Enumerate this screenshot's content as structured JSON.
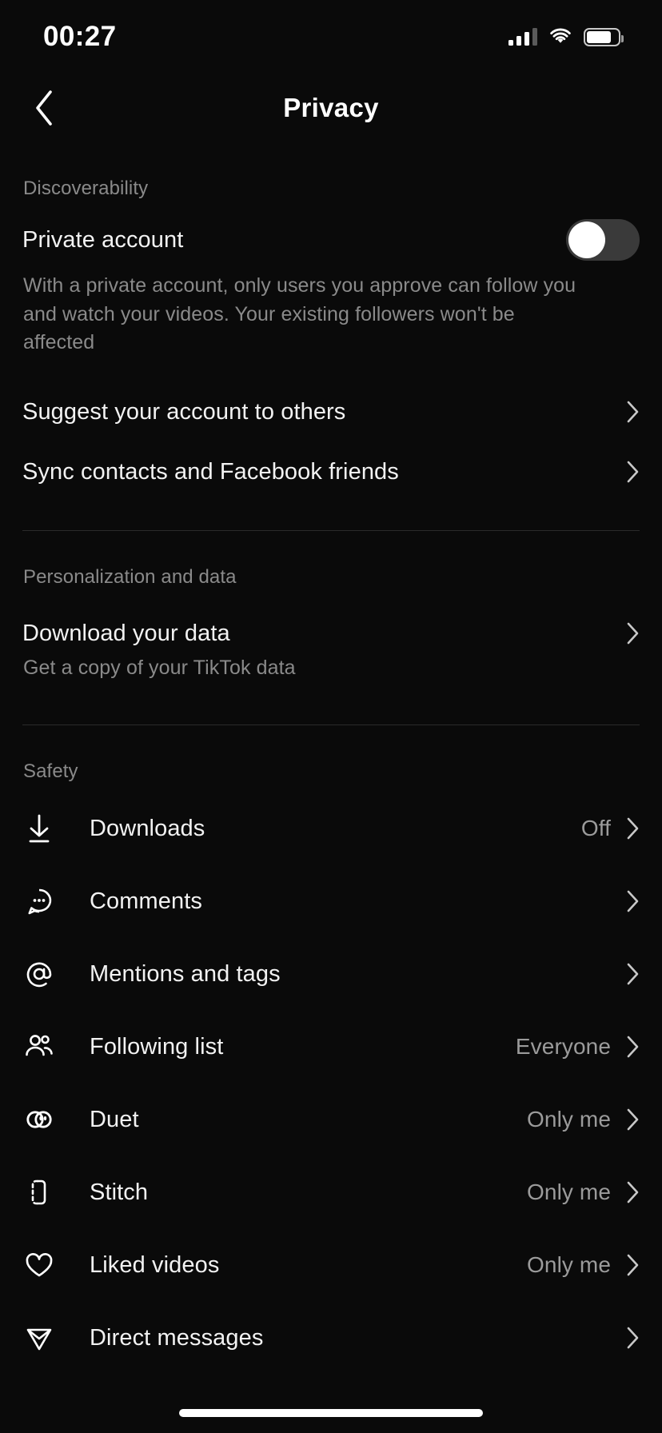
{
  "status_bar": {
    "time": "00:27",
    "signal_icon": "cellular-signal-icon",
    "wifi_icon": "wifi-icon",
    "battery_icon": "battery-icon",
    "battery_level": "80"
  },
  "nav": {
    "back_icon": "chevron-left-icon",
    "title": "Privacy"
  },
  "sections": {
    "discoverability": {
      "header": "Discoverability",
      "private_account": {
        "label": "Private account",
        "toggle_state": "off",
        "description": "With a private account, only users you approve can follow you and watch your videos. Your existing followers won't be affected"
      },
      "rows": [
        {
          "label": "Suggest your account to others",
          "value": "",
          "chevron": "chevron-right-icon"
        },
        {
          "label": "Sync contacts and Facebook friends",
          "value": "",
          "chevron": "chevron-right-icon"
        }
      ]
    },
    "personalization": {
      "header": "Personalization and data",
      "rows": [
        {
          "label": "Download your data",
          "value": "",
          "subtitle": "Get a copy of your TikTok data",
          "chevron": "chevron-right-icon"
        }
      ]
    },
    "safety": {
      "header": "Safety",
      "rows": [
        {
          "label": "Downloads",
          "value": "Off",
          "icon": "download-icon",
          "chevron": "chevron-right-icon"
        },
        {
          "label": "Comments",
          "value": "",
          "icon": "comment-bubble-icon",
          "chevron": "chevron-right-icon"
        },
        {
          "label": "Mentions and tags",
          "value": "",
          "icon": "at-mention-icon",
          "chevron": "chevron-right-icon"
        },
        {
          "label": "Following list",
          "value": "Everyone",
          "icon": "people-icon",
          "chevron": "chevron-right-icon"
        },
        {
          "label": "Duet",
          "value": "Only me",
          "icon": "duet-circles-icon",
          "chevron": "chevron-right-icon"
        },
        {
          "label": "Stitch",
          "value": "Only me",
          "icon": "stitch-frame-icon",
          "chevron": "chevron-right-icon"
        },
        {
          "label": "Liked videos",
          "value": "Only me",
          "icon": "heart-icon",
          "chevron": "chevron-right-icon"
        },
        {
          "label": "Direct messages",
          "value": "",
          "icon": "send-plane-icon",
          "chevron": "chevron-right-icon"
        }
      ]
    }
  },
  "colors": {
    "background": "#0a0a0a",
    "primary_text": "#f2f2f2",
    "secondary_text": "#8a8a8a",
    "divider": "#2b2b2b",
    "toggle_off_track": "#3a3a3a"
  }
}
